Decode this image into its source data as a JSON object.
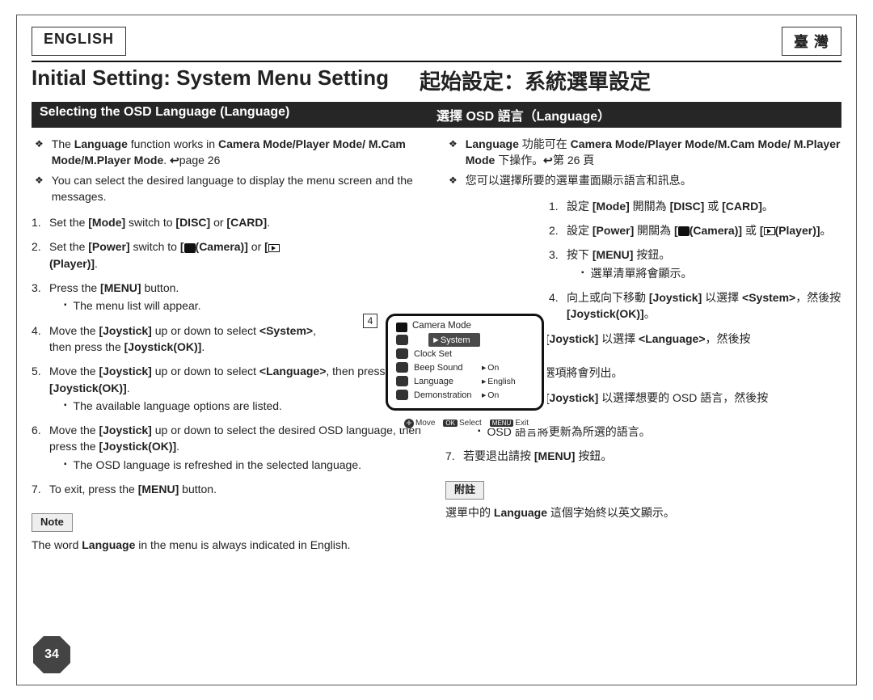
{
  "lang_left": "ENGLISH",
  "lang_right": "臺 灣",
  "title_en": "Initial Setting: System Menu Setting",
  "title_zh": "起始設定：系統選單設定",
  "stripe_en": "Selecting the OSD Language (Language)",
  "stripe_zh": "選擇 OSD 語言（Language）",
  "en": {
    "b1": "The <b>Language</b> function works in <b>Camera Mode/Player Mode/ M.Cam Mode/M.Player Mode</b>. <span class='arrow-ref'>↪</span>page 26",
    "b2": "You can select the desired language to display the menu screen and the messages.",
    "s1": "Set the <b>[Mode]</b> switch to <b>[DISC]</b> or <b>[CARD]</b>.",
    "s2": "Set the <b>[Power]</b> switch to <b>[<span class='cam-icon'></span>(Camera)]</b> or <b>[<span class='play-icon'></span>(Player)]</b>.",
    "s3": "Press the <b>[MENU]</b> button.",
    "s3a": "The menu list will appear.",
    "s4": "Move the <b>[Joystick]</b> up or down to select <b>&lt;System&gt;</b>, then press the <b>[Joystick(OK)]</b>.",
    "s5": "Move the <b>[Joystick]</b> up or down to select <b>&lt;Language&gt;</b>, then press the <b>[Joystick(OK)]</b>.",
    "s5a": "The available language options are listed.",
    "s6": "Move the <b>[Joystick]</b> up or down to select the desired OSD language, then press the <b>[Joystick(OK)]</b>.",
    "s6a": "The OSD language is refreshed in the selected language.",
    "s7": "To exit, press the <b>[MENU]</b> button.",
    "note_label": "Note",
    "note_text": "The word <b>Language</b> in the menu is always indicated in English."
  },
  "zh": {
    "b1": "<b>Language</b> 功能可在 <b>Camera Mode/Player Mode/M.Cam Mode/ M.Player Mode</b> 下操作。<span class='arrow-ref'>↪</span>第 26 頁",
    "b2": "您可以選擇所要的選單畫面顯示語言和訊息。",
    "s1": "設定 <b>[Mode]</b> 開關為 <b>[DISC]</b> 或 <b>[CARD]</b>。",
    "s2": "設定 <b>[Power]</b> 開關為 <b>[<span class='cam-icon'></span>(Camera)]</b> 或 <b>[<span class='play-icon'></span>(Player)]</b>。",
    "s3": "按下 <b>[MENU]</b> 按鈕。",
    "s3a": "選單清單將會顯示。",
    "s4": "向上或向下移動 <b>[Joystick]</b> 以選擇 <b>&lt;System&gt;</b>，然後按 <b>[Joystick(OK)]</b>。",
    "s5": "向上或向下移動 <b>[Joystick]</b> 以選擇 <b>&lt;Language&gt;</b>，然後按 <b>[Joystick(OK)]</b>。",
    "s5a": "可用的語言選項將會列出。",
    "s6": "向上或向下移動 <b>[Joystick]</b> 以選擇想要的 OSD 語言，然後按 <b>[Joystick(OK)]</b>。",
    "s6a": "OSD 語言將更新為所選的語言。",
    "s7": "若要退出請按 <b>[MENU]</b> 按鈕。",
    "note_label": "附註",
    "note_text": "選單中的 <b>Language</b> 這個字始終以英文顯示。"
  },
  "diagram": {
    "step": "4",
    "title": "Camera Mode",
    "system": "►System",
    "rows": [
      {
        "label": "Clock Set",
        "value": ""
      },
      {
        "label": "Beep Sound",
        "value": "On"
      },
      {
        "label": "Language",
        "value": "English"
      },
      {
        "label": "Demonstration",
        "value": "On"
      }
    ],
    "footer": {
      "move": "Move",
      "select": "Select",
      "exit": "Exit"
    }
  },
  "page_number": "34"
}
